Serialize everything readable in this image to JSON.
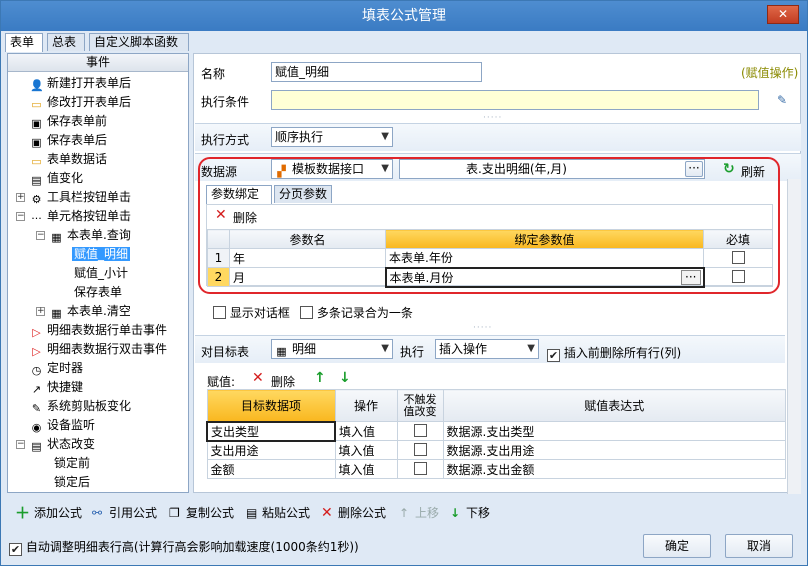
{
  "window": {
    "title": "填表公式管理",
    "close": "✕"
  },
  "tabs": [
    "表单",
    "总表",
    "自定义脚本函数"
  ],
  "left": {
    "header": "事件",
    "items": [
      "新建打开表单后",
      "修改打开表单后",
      "保存表单前",
      "保存表单后",
      "表单数据话",
      "值变化",
      "工具栏按钮单击",
      "单元格按钮单击",
      "本表单.查询",
      "赋值_明细",
      "赋值_小计",
      "保存表单",
      "本表单.清空",
      "明细表数据行单击事件",
      "明细表数据行双击事件",
      "定时器",
      "快捷键",
      "系统剪贴板变化",
      "设备监听",
      "状态改变",
      "锁定前",
      "锁定后"
    ]
  },
  "form": {
    "name_label": "名称",
    "name_value": "赋值_明细",
    "type_tag": "(赋值操作)",
    "cond_label": "执行条件",
    "cond_value": "",
    "exec_label": "执行方式",
    "exec_value": "顺序执行"
  },
  "datasource": {
    "label": "数据源",
    "type": "模板数据接口",
    "path_value": "表.支出明细(年,月)",
    "refresh": "刷新",
    "tabs": [
      "参数绑定",
      "分页参数"
    ],
    "delete": "删除",
    "cols": [
      "参数名",
      "绑定参数值",
      "必填"
    ],
    "rows": [
      {
        "no": "1",
        "name": "年",
        "value": "本表单.年份"
      },
      {
        "no": "2",
        "name": "月",
        "value": "本表单.月份"
      }
    ],
    "show_dialog": "显示对话框",
    "merge_records": "多条记录合为一条"
  },
  "target": {
    "label": "对目标表",
    "table": "明细",
    "exec_label": "执行",
    "exec_value": "插入操作",
    "clear_label": "插入前删除所有行(列)",
    "assign_label": "赋值:",
    "delete": "删除",
    "cols": [
      "目标数据项",
      "操作",
      "不触发值改变",
      "赋值表达式"
    ],
    "rows": [
      {
        "item": "支出类型",
        "op": "填入值",
        "expr": "数据源.支出类型"
      },
      {
        "item": "支出用途",
        "op": "填入值",
        "expr": "数据源.支出用途"
      },
      {
        "item": "金额",
        "op": "填入值",
        "expr": "数据源.支出金额"
      }
    ]
  },
  "toolbar": {
    "add": "添加公式",
    "ref": "引用公式",
    "copy": "复制公式",
    "paste": "粘贴公式",
    "del": "删除公式",
    "up": "上移",
    "down": "下移"
  },
  "footer": {
    "auto_height": "自动调整明细表行高(计算行高会影响加载速度(1000条约1秒))",
    "ok": "确定",
    "cancel": "取消"
  }
}
